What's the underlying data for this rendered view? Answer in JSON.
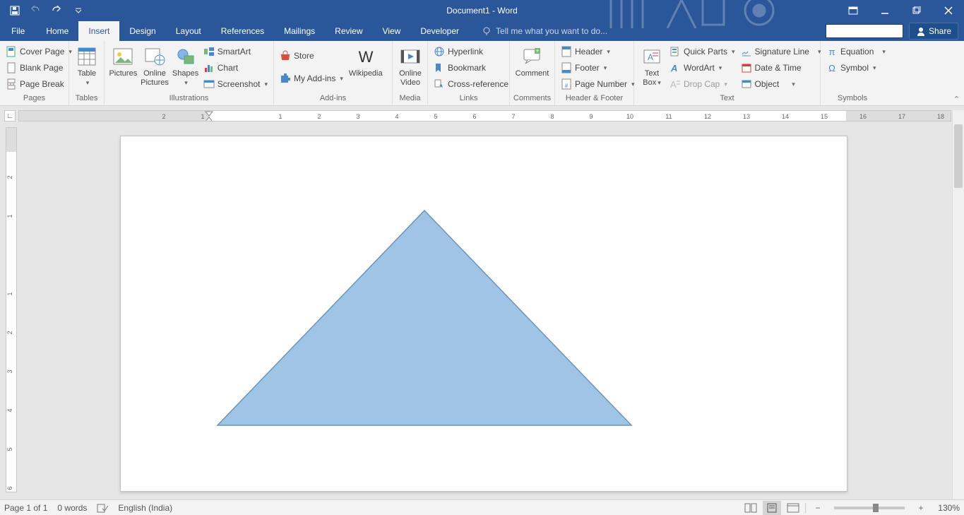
{
  "title": "Document1 - Word",
  "tabs": {
    "file": "File",
    "home": "Home",
    "insert": "Insert",
    "design": "Design",
    "layout": "Layout",
    "references": "References",
    "mailings": "Mailings",
    "review": "Review",
    "view": "View",
    "developer": "Developer"
  },
  "tellme": "Tell me what you want to do...",
  "share": "Share",
  "ribbon": {
    "pages": {
      "label": "Pages",
      "cover": "Cover Page",
      "blank": "Blank Page",
      "break": "Page Break"
    },
    "tables": {
      "label": "Tables",
      "table": "Table"
    },
    "illus": {
      "label": "Illustrations",
      "pictures": "Pictures",
      "online": "Online\nPictures",
      "shapes": "Shapes",
      "smartart": "SmartArt",
      "chart": "Chart",
      "screenshot": "Screenshot"
    },
    "addins": {
      "label": "Add-ins",
      "store": "Store",
      "myaddins": "My Add-ins",
      "wiki": "Wikipedia"
    },
    "media": {
      "label": "Media",
      "video": "Online\nVideo"
    },
    "links": {
      "label": "Links",
      "hyper": "Hyperlink",
      "bookmark": "Bookmark",
      "cross": "Cross-reference"
    },
    "comments": {
      "label": "Comments",
      "comment": "Comment"
    },
    "hf": {
      "label": "Header & Footer",
      "header": "Header",
      "footer": "Footer",
      "pagenum": "Page Number"
    },
    "text": {
      "label": "Text",
      "textbox": "Text\nBox",
      "quick": "Quick Parts",
      "wordart": "WordArt",
      "dropcap": "Drop Cap",
      "sig": "Signature Line",
      "datetime": "Date & Time",
      "object": "Object"
    },
    "symbols": {
      "label": "Symbols",
      "equation": "Equation",
      "symbol": "Symbol"
    }
  },
  "status": {
    "page": "Page 1 of 1",
    "words": "0 words",
    "lang": "English (India)",
    "zoom": "130%"
  }
}
